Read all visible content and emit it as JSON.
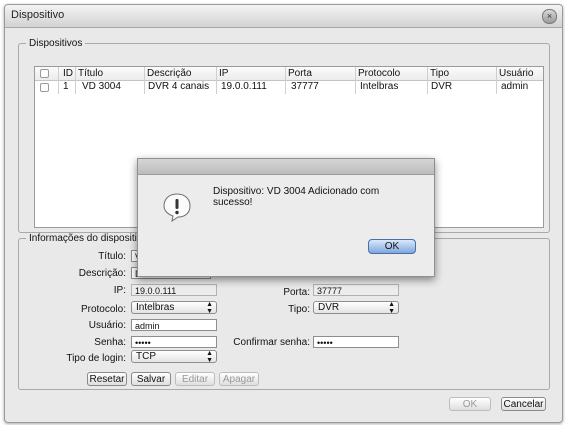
{
  "window": {
    "title": "Dispositivo",
    "close_glyph": "×"
  },
  "devices_group": {
    "legend": "Dispositivos",
    "columns": [
      "ID",
      "Título",
      "Descrição",
      "IP",
      "Porta",
      "Protocolo",
      "Tipo",
      "Usuário"
    ],
    "rows": [
      {
        "id": "1",
        "titulo": "VD 3004",
        "descricao": "DVR 4 canais",
        "ip": "19.0.0.111",
        "porta": "37777",
        "protocolo": "Intelbras",
        "tipo": "DVR",
        "usuario": "admin"
      }
    ]
  },
  "info_group": {
    "legend": "Informações do dispositivo",
    "fields": {
      "titulo_label": "Título:",
      "titulo_value": "V",
      "descricao_label": "Descrição:",
      "descricao_value": "D",
      "ip_label": "IP:",
      "ip_value": "19.0.0.111",
      "porta_label": "Porta:",
      "porta_value": "37777",
      "protocolo_label": "Protocolo:",
      "protocolo_value": "Intelbras",
      "tipo_label": "Tipo:",
      "tipo_value": "DVR",
      "usuario_label": "Usuário:",
      "usuario_value": "admin",
      "senha_label": "Senha:",
      "senha_value": "•••••",
      "confirmar_label": "Confirmar senha:",
      "confirmar_value": "•••••",
      "tipo_login_label": "Tipo de login:",
      "tipo_login_value": "TCP"
    },
    "buttons": {
      "resetar": "Resetar",
      "salvar": "Salvar",
      "editar": "Editar",
      "apagar": "Apagar"
    }
  },
  "footer": {
    "ok": "OK",
    "cancelar": "Cancelar"
  },
  "alert": {
    "message": "Dispositivo: VD 3004 Adicionado com sucesso!",
    "ok": "OK",
    "icon": "warning-icon"
  }
}
